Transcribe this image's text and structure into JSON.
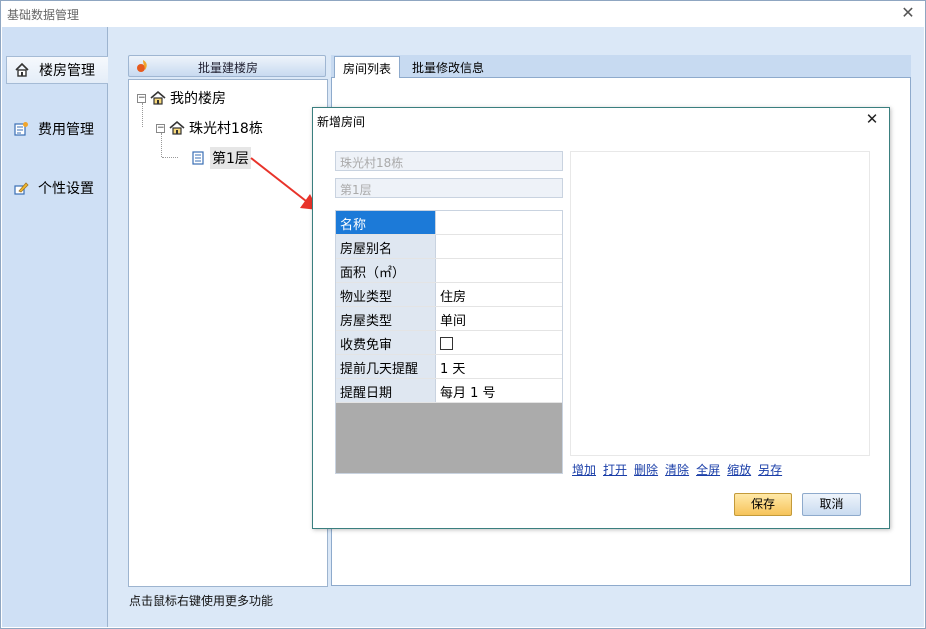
{
  "window": {
    "title": "基础数据管理"
  },
  "nav": {
    "items": [
      {
        "label": "楼房管理",
        "icon": "home-icon",
        "active": true
      },
      {
        "label": "费用管理",
        "icon": "ledger-icon",
        "active": false
      },
      {
        "label": "个性设置",
        "icon": "settings-edit-icon",
        "active": false
      }
    ]
  },
  "tree": {
    "header_label": "批量建楼房",
    "root": "我的楼房",
    "building": "珠光村18栋",
    "floor": "第1层"
  },
  "status": {
    "hint": "点击鼠标右键使用更多功能"
  },
  "tabs": [
    {
      "label": "房间列表",
      "active": true
    },
    {
      "label": "批量修改信息",
      "active": false
    }
  ],
  "dialog": {
    "title": "新增房间",
    "building_field": "珠光村18栋",
    "floor_field": "第1层",
    "properties": [
      {
        "key": "名称",
        "value": ""
      },
      {
        "key": "房屋别名",
        "value": ""
      },
      {
        "key": "面积（㎡）",
        "value": ""
      },
      {
        "key": "物业类型",
        "value": "住房"
      },
      {
        "key": "房屋类型",
        "value": "单间"
      },
      {
        "key": "收费免审",
        "value": ""
      },
      {
        "key": "提前几天提醒",
        "value": " 1 天"
      },
      {
        "key": "提醒日期",
        "value": "每月 1 号"
      }
    ],
    "links": [
      "增加",
      "打开",
      "删除",
      "清除",
      "全屏",
      "缩放",
      "另存"
    ],
    "save_label": "保存",
    "cancel_label": "取消"
  },
  "colors": {
    "accent_selected": "#1c7ad8",
    "arrow": "#e8332a"
  }
}
